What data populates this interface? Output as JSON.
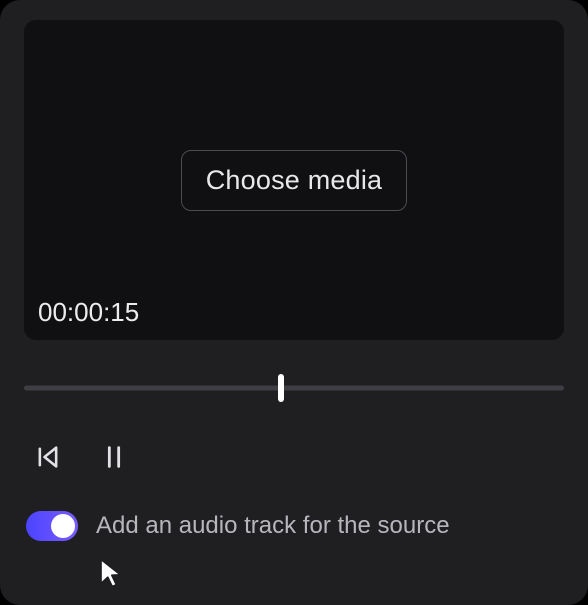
{
  "media": {
    "choose_label": "Choose media",
    "timestamp": "00:00:15"
  },
  "playback": {
    "seek_progress_pct": 47.5
  },
  "audio": {
    "toggle_on": true,
    "label": "Add an audio track for the source"
  },
  "icons": {
    "skip_back": "skip-back-icon",
    "pause": "pause-icon",
    "cursor": "cursor-icon"
  }
}
